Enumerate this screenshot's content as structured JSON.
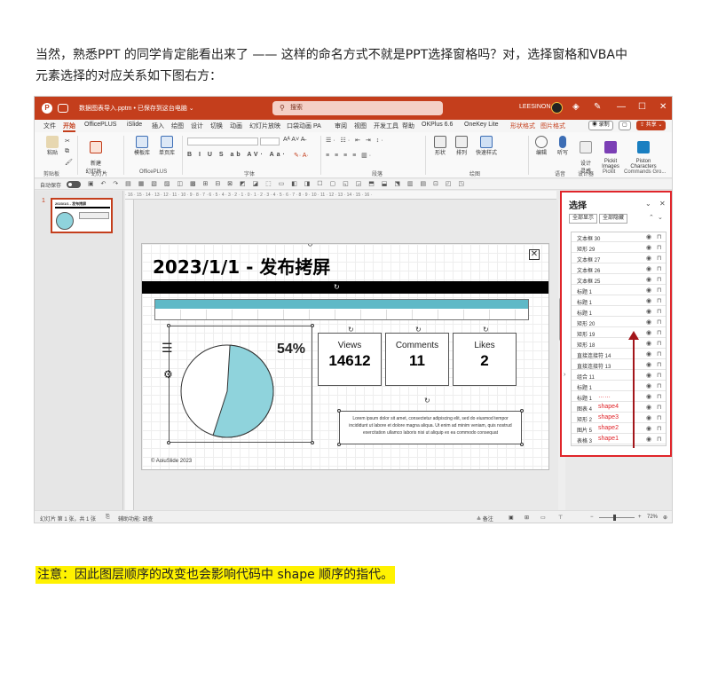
{
  "intro": {
    "line1": "当然，熟悉PPT 的同学肯定能看出来了 —— 这样的命名方式不就是PPT选择窗格吗？对，选择窗格和VBA中",
    "line2": "元素选择的对应关系如下图右方："
  },
  "window": {
    "app_letter": "P",
    "filename": "数据图表导入.pptm • 已保存到这台电脑 ⌄",
    "search_placeholder": "搜索",
    "search_icon": "search-icon",
    "user": "LEESINON",
    "win_min": "—",
    "win_max": "☐",
    "win_close": "✕",
    "accent": "#c43e1c"
  },
  "tabs": [
    "文件",
    "开始",
    "OfficePLUS",
    "iSlide",
    "插入",
    "绘图",
    "设计",
    "切换",
    "动画",
    "幻灯片放映",
    "口袋动画 PA",
    "审阅",
    "视图",
    "开发工具",
    "帮助",
    "OKPlus 6.6",
    "OneKey Lite",
    "形状格式",
    "图片格式"
  ],
  "tab_actions": {
    "record": "◉ 录制",
    "comment": "▢",
    "share": "⇪ 共享 ⌄"
  },
  "ribbon": {
    "paste": "粘贴",
    "new_slide": "新建\n幻灯片⌄",
    "template": "模板库",
    "single_page": "单页库",
    "shape": "形状",
    "arrange": "排列",
    "quick_style": "快速样式",
    "edit": "编辑",
    "dictate": "听写",
    "design": "设计\n灵感",
    "pickit_images": "Pickit\nImages",
    "piston": "Piston\nCharacters",
    "groups": [
      "剪贴板",
      "幻灯片",
      "OfficePLUS",
      "字体",
      "段落",
      "绘图",
      "语音",
      "设计器",
      "Pickit",
      "Commands Gro..."
    ]
  },
  "qbar": {
    "autosave": "自动保存"
  },
  "slide": {
    "number": "1",
    "title": "2023/1/1 - 发布拷屏",
    "thumb_title": "2023/1/1 - 发布拷屏",
    "pie_percent": "54%",
    "stats": [
      {
        "label": "Views",
        "value": "14612"
      },
      {
        "label": "Comments",
        "value": "11"
      },
      {
        "label": "Likes",
        "value": "2"
      }
    ],
    "lorem": "Lorem ipsum dolor sit amet, consectetur adipiscing elit, sed do eiusmod tempor incididunt ut labore et dolore magna aliqua. Ut enim ad minim veniam, quis nostrud exercitation ullamco laboris nisi ut aliquip ex ea commodo consequat",
    "footer": "© AoiuSlide 2023",
    "pie_color": "#8fd3dc"
  },
  "pane": {
    "title": "选择",
    "show_all": "全部显示",
    "hide_all": "全部隐藏",
    "items": [
      {
        "name": "文本框 30",
        "tag": ""
      },
      {
        "name": "矩形 29",
        "tag": ""
      },
      {
        "name": "文本框 27",
        "tag": ""
      },
      {
        "name": "文本框 26",
        "tag": ""
      },
      {
        "name": "文本框 25",
        "tag": ""
      },
      {
        "name": "标题 1",
        "tag": ""
      },
      {
        "name": "标题 1",
        "tag": ""
      },
      {
        "name": "标题 1",
        "tag": ""
      },
      {
        "name": "矩形 20",
        "tag": ""
      },
      {
        "name": "矩形 19",
        "tag": ""
      },
      {
        "name": "矩形 18",
        "tag": ""
      },
      {
        "name": "直接连接符 14",
        "tag": ""
      },
      {
        "name": "直接连接符 13",
        "tag": ""
      },
      {
        "name": "组合 11",
        "tag": ""
      },
      {
        "name": "标题 1",
        "tag": ""
      },
      {
        "name": "标题 1",
        "tag": "……"
      },
      {
        "name": "图表 4",
        "tag": "shape4"
      },
      {
        "name": "矩形 2",
        "tag": "shape3"
      },
      {
        "name": "图片 5",
        "tag": "shape2"
      },
      {
        "name": "表格 3",
        "tag": "shape1"
      }
    ],
    "annotation_color": "#e0252a"
  },
  "status": {
    "slide_of": "幻灯片 第 1 张，共 1 张",
    "accessibility": "辅助功能: 调查",
    "notes": "≜ 备注",
    "zoom": "72%"
  },
  "note": "注意：因此图层顺序的改变也会影响代码中 shape 顺序的指代。"
}
